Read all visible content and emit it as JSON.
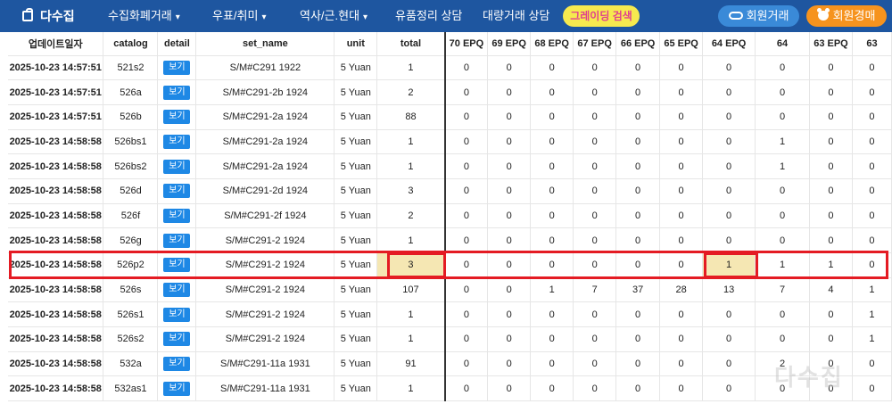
{
  "nav": {
    "brand": "다수집",
    "menu": [
      {
        "label": "수집화폐거래",
        "has_caret": true
      },
      {
        "label": "우표/취미",
        "has_caret": true
      },
      {
        "label": "역사/근.현대",
        "has_caret": true
      },
      {
        "label": "유품정리 상담",
        "has_caret": false
      },
      {
        "label": "대량거래 상담",
        "has_caret": false
      }
    ],
    "grading_search": "그레이딩 검색",
    "member_trade": "회원거래",
    "member_auction": "회원경매",
    "caret_glyph": "▾"
  },
  "table": {
    "columns": [
      "업데이트일자",
      "catalog",
      "detail",
      "set_name",
      "unit",
      "total",
      "70 EPQ",
      "69 EPQ",
      "68 EPQ",
      "67 EPQ",
      "66 EPQ",
      "65 EPQ",
      "64 EPQ",
      "64",
      "63 EPQ",
      "63"
    ],
    "detail_label": "보기",
    "rows": [
      [
        "2025-10-23 14:57:51",
        "521s2",
        "S/M#C291 1922",
        "5 Yuan",
        "1",
        "0",
        "0",
        "0",
        "0",
        "0",
        "0",
        "0",
        "0",
        "0",
        "0"
      ],
      [
        "2025-10-23 14:57:51",
        "526a",
        "S/M#C291-2b 1924",
        "5 Yuan",
        "2",
        "0",
        "0",
        "0",
        "0",
        "0",
        "0",
        "0",
        "0",
        "0",
        "0"
      ],
      [
        "2025-10-23 14:57:51",
        "526b",
        "S/M#C291-2a 1924",
        "5 Yuan",
        "88",
        "0",
        "0",
        "0",
        "0",
        "0",
        "0",
        "0",
        "0",
        "0",
        "0"
      ],
      [
        "2025-10-23 14:58:58",
        "526bs1",
        "S/M#C291-2a 1924",
        "5 Yuan",
        "1",
        "0",
        "0",
        "0",
        "0",
        "0",
        "0",
        "0",
        "1",
        "0",
        "0"
      ],
      [
        "2025-10-23 14:58:58",
        "526bs2",
        "S/M#C291-2a 1924",
        "5 Yuan",
        "1",
        "0",
        "0",
        "0",
        "0",
        "0",
        "0",
        "0",
        "1",
        "0",
        "0"
      ],
      [
        "2025-10-23 14:58:58",
        "526d",
        "S/M#C291-2d 1924",
        "5 Yuan",
        "3",
        "0",
        "0",
        "0",
        "0",
        "0",
        "0",
        "0",
        "0",
        "0",
        "0"
      ],
      [
        "2025-10-23 14:58:58",
        "526f",
        "S/M#C291-2f 1924",
        "5 Yuan",
        "2",
        "0",
        "0",
        "0",
        "0",
        "0",
        "0",
        "0",
        "0",
        "0",
        "0"
      ],
      [
        "2025-10-23 14:58:58",
        "526g",
        "S/M#C291-2 1924",
        "5 Yuan",
        "1",
        "0",
        "0",
        "0",
        "0",
        "0",
        "0",
        "0",
        "0",
        "0",
        "0"
      ],
      [
        "2025-10-23 14:58:58",
        "526p2",
        "S/M#C291-2 1924",
        "5 Yuan",
        "3",
        "0",
        "0",
        "0",
        "0",
        "0",
        "0",
        "1",
        "1",
        "1",
        "0"
      ],
      [
        "2025-10-23 14:58:58",
        "526s",
        "S/M#C291-2 1924",
        "5 Yuan",
        "107",
        "0",
        "0",
        "1",
        "7",
        "37",
        "28",
        "13",
        "7",
        "4",
        "1"
      ],
      [
        "2025-10-23 14:58:58",
        "526s1",
        "S/M#C291-2 1924",
        "5 Yuan",
        "1",
        "0",
        "0",
        "0",
        "0",
        "0",
        "0",
        "0",
        "0",
        "0",
        "1"
      ],
      [
        "2025-10-23 14:58:58",
        "526s2",
        "S/M#C291-2 1924",
        "5 Yuan",
        "1",
        "0",
        "0",
        "0",
        "0",
        "0",
        "0",
        "0",
        "0",
        "0",
        "1"
      ],
      [
        "2025-10-23 14:58:58",
        "532a",
        "S/M#C291-11a 1931",
        "5 Yuan",
        "91",
        "0",
        "0",
        "0",
        "0",
        "0",
        "0",
        "0",
        "2",
        "0",
        "0"
      ],
      [
        "2025-10-23 14:58:58",
        "532as1",
        "S/M#C291-11a 1931",
        "5 Yuan",
        "1",
        "0",
        "0",
        "0",
        "0",
        "0",
        "0",
        "0",
        "0",
        "0",
        "0"
      ]
    ],
    "highlighted_row_index": 8,
    "highlighted_cells": [
      "total",
      "64 EPQ"
    ]
  },
  "watermark": "다수집",
  "colors": {
    "nav_bg": "#1e56a0",
    "grading_bg": "#f6e94f",
    "grading_text": "#e0418e",
    "member_trade_bg": "#3a8ad8",
    "member_auction_bg": "#f6931e",
    "detail_btn": "#1e88e5",
    "highlight_border": "#e41b23",
    "highlight_fill": "#f5e7b3"
  }
}
